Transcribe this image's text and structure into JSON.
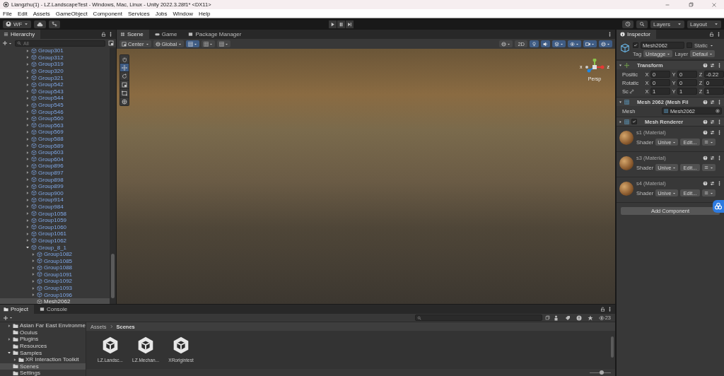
{
  "window": {
    "title": "Liangzhu(1) - LZ.LandscapeTest - Windows, Mac, Linux - Unity 2022.3.28f1* <DX11>"
  },
  "menu": [
    "File",
    "Edit",
    "Assets",
    "GameObject",
    "Component",
    "Services",
    "Jobs",
    "Window",
    "Help"
  ],
  "toolbar": {
    "account": "WF",
    "layers": "Layers",
    "layout": "Layout"
  },
  "hierarchy": {
    "title": "Hierarchy",
    "search": {
      "placeholder": "All"
    },
    "items": [
      {
        "label": "Group301",
        "kind": "prefab",
        "expanded": false,
        "selected": false
      },
      {
        "label": "Group312",
        "kind": "prefab",
        "expanded": false,
        "selected": false
      },
      {
        "label": "Group319",
        "kind": "prefab",
        "expanded": false,
        "selected": false
      },
      {
        "label": "Group320",
        "kind": "prefab",
        "expanded": false,
        "selected": false
      },
      {
        "label": "Group321",
        "kind": "prefab",
        "expanded": false,
        "selected": false
      },
      {
        "label": "Group542",
        "kind": "prefab",
        "expanded": false,
        "selected": false
      },
      {
        "label": "Group543",
        "kind": "prefab",
        "expanded": false,
        "selected": false
      },
      {
        "label": "Group544",
        "kind": "prefab",
        "expanded": false,
        "selected": false
      },
      {
        "label": "Group545",
        "kind": "prefab",
        "expanded": false,
        "selected": false
      },
      {
        "label": "Group546",
        "kind": "prefab",
        "expanded": false,
        "selected": false
      },
      {
        "label": "Group560",
        "kind": "prefab",
        "expanded": false,
        "selected": false
      },
      {
        "label": "Group563",
        "kind": "prefab",
        "expanded": false,
        "selected": false
      },
      {
        "label": "Group569",
        "kind": "prefab",
        "expanded": false,
        "selected": false
      },
      {
        "label": "Group588",
        "kind": "prefab",
        "expanded": false,
        "selected": false
      },
      {
        "label": "Group589",
        "kind": "prefab",
        "expanded": false,
        "selected": false
      },
      {
        "label": "Group603",
        "kind": "prefab",
        "expanded": false,
        "selected": false
      },
      {
        "label": "Group604",
        "kind": "prefab",
        "expanded": false,
        "selected": false
      },
      {
        "label": "Group896",
        "kind": "prefab",
        "expanded": false,
        "selected": false
      },
      {
        "label": "Group897",
        "kind": "prefab",
        "expanded": false,
        "selected": false
      },
      {
        "label": "Group898",
        "kind": "prefab",
        "expanded": false,
        "selected": false
      },
      {
        "label": "Group899",
        "kind": "prefab",
        "expanded": false,
        "selected": false
      },
      {
        "label": "Group900",
        "kind": "prefab",
        "expanded": false,
        "selected": false
      },
      {
        "label": "Group914",
        "kind": "prefab",
        "expanded": false,
        "selected": false
      },
      {
        "label": "Group984",
        "kind": "prefab",
        "expanded": false,
        "selected": false
      },
      {
        "label": "Group1058",
        "kind": "prefab",
        "expanded": false,
        "selected": false
      },
      {
        "label": "Group1059",
        "kind": "prefab",
        "expanded": false,
        "selected": false
      },
      {
        "label": "Group1060",
        "kind": "prefab",
        "expanded": false,
        "selected": false
      },
      {
        "label": "Group1061",
        "kind": "prefab",
        "expanded": false,
        "selected": false
      },
      {
        "label": "Group1062",
        "kind": "prefab",
        "expanded": false,
        "selected": false
      },
      {
        "label": "Group_8_1",
        "kind": "prefab",
        "expanded": true,
        "selected": false,
        "children": [
          {
            "label": "Group1082",
            "kind": "prefab",
            "expanded": false,
            "selected": false
          },
          {
            "label": "Group1085",
            "kind": "prefab",
            "expanded": false,
            "selected": false
          },
          {
            "label": "Group1088",
            "kind": "prefab",
            "expanded": false,
            "selected": false
          },
          {
            "label": "Group1091",
            "kind": "prefab",
            "expanded": false,
            "selected": false
          },
          {
            "label": "Group1092",
            "kind": "prefab",
            "expanded": false,
            "selected": false
          },
          {
            "label": "Group1093",
            "kind": "prefab",
            "expanded": false,
            "selected": false
          },
          {
            "label": "Group1096",
            "kind": "prefab",
            "expanded": false,
            "selected": false
          },
          {
            "label": "Mesh2062",
            "kind": "object",
            "selected": true
          }
        ]
      }
    ]
  },
  "scene": {
    "tabs": [
      {
        "label": "Scene",
        "kind": "scene",
        "selected": true
      },
      {
        "label": "Game",
        "kind": "game",
        "selected": false
      },
      {
        "label": "Package Manager",
        "kind": "package",
        "selected": false
      }
    ],
    "pivot": "Center",
    "space": "Global",
    "mode_2d": "2D",
    "gizmo_axes": [
      "x",
      "z"
    ],
    "projection": "Persp"
  },
  "inspector": {
    "title": "Inspector",
    "name": "Mesh2062",
    "active": true,
    "static_label": "Static",
    "static": false,
    "tag_label": "Tag",
    "tag": "Untagge",
    "layer_label": "Layer",
    "layer": "Defaul",
    "components": [
      {
        "kind": "transform",
        "title": "Transform",
        "expanded": true,
        "rows": [
          {
            "label": "Positic",
            "linked": false,
            "values": [
              {
                "axis": "X",
                "value": "0"
              },
              {
                "axis": "Y",
                "value": "0"
              },
              {
                "axis": "Z",
                "value": "-0.22"
              }
            ]
          },
          {
            "label": "Rotatic",
            "linked": false,
            "values": [
              {
                "axis": "X",
                "value": "0"
              },
              {
                "axis": "Y",
                "value": "0"
              },
              {
                "axis": "Z",
                "value": "0"
              }
            ]
          },
          {
            "label": "Sc",
            "linked": true,
            "values": [
              {
                "axis": "X",
                "value": "1"
              },
              {
                "axis": "Y",
                "value": "1"
              },
              {
                "axis": "Z",
                "value": "1"
              }
            ]
          }
        ]
      },
      {
        "kind": "mesh_filter",
        "title": "Mesh 2062 (Mesh Fil",
        "expanded": true,
        "field_label": "Mesh",
        "field_value": "Mesh2062"
      },
      {
        "kind": "renderer",
        "title": "Mesh Renderer",
        "expanded": false,
        "enabled": true
      }
    ],
    "materials": [
      {
        "name": "s1 (Material)",
        "shader_label": "Shader",
        "shader": "Unive",
        "edit": "Edit..."
      },
      {
        "name": "s3 (Material)",
        "shader_label": "Shader",
        "shader": "Unive",
        "edit": "Edit..."
      },
      {
        "name": "s4 (Material)",
        "shader_label": "Shader",
        "shader": "Unive",
        "edit": "Edit..."
      }
    ],
    "add_component": "Add Component"
  },
  "project": {
    "tabs": [
      {
        "label": "Project",
        "kind": "project",
        "selected": true
      },
      {
        "label": "Console",
        "kind": "console",
        "selected": false
      }
    ],
    "hidden_count": "23",
    "tree": [
      {
        "label": "Asian Far East Environme",
        "expanded": false,
        "selected": false
      },
      {
        "label": "Oculus",
        "selected": false
      },
      {
        "label": "Plugins",
        "expanded": false,
        "selected": false
      },
      {
        "label": "Resources",
        "selected": false
      },
      {
        "label": "Samples",
        "expanded": true,
        "selected": false,
        "children": [
          {
            "label": "XR Interaction Toolkit",
            "expanded": false,
            "selected": false
          }
        ]
      },
      {
        "label": "Scenes",
        "selected": true
      },
      {
        "label": "Settings",
        "selected": false
      }
    ],
    "breadcrumb": [
      "Assets",
      "Scenes"
    ],
    "assets": [
      "LZ.Landsc...",
      "LZ.Mechan...",
      "XRorigintest"
    ],
    "zoom": {
      "level": 0.55
    }
  }
}
